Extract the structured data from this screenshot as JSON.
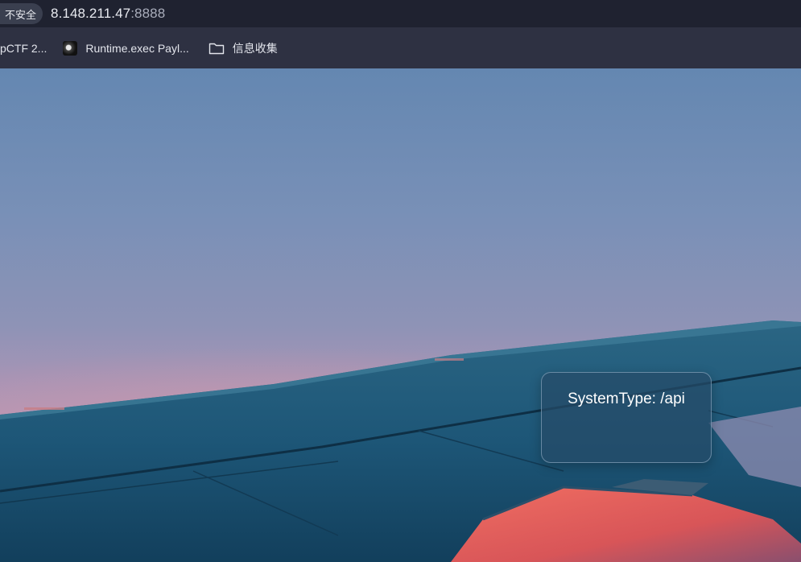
{
  "browser": {
    "security_label": "不安全",
    "url_host": "8.148.211.47",
    "url_port": ":8888"
  },
  "bookmarks": [
    {
      "label": "pCTF 2...",
      "icon": "none"
    },
    {
      "label": "Runtime.exec Payl...",
      "icon": "favicon"
    },
    {
      "label": "信息收集",
      "icon": "folder-icon"
    }
  ],
  "page": {
    "info_text": "SystemType: /api"
  },
  "colors": {
    "sky_top": "#6487b1",
    "sky_pink": "#b796b4",
    "wing_blue": "#1f5676",
    "engine_red": "#e0605c"
  }
}
